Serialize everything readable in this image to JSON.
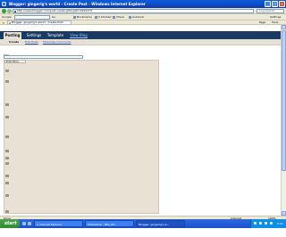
{
  "window": {
    "title": "Blogger: gingerig's world - Create Post - Windows Internet Explorer",
    "minimize_glyph": "_",
    "maximize_glyph": "□",
    "close_glyph": "✕"
  },
  "address": {
    "url": "http://www.blogger.com/post-create.g?blogID=2999370",
    "search_placeholder": "Live Search"
  },
  "toolbar": {
    "google_label": "Google",
    "go_label": "Go",
    "bookmarks": "Bookmarks",
    "blocked": "0 blocked",
    "check": "Check",
    "autolink": "AutoLink",
    "settings": "Settings"
  },
  "tab": {
    "title": "Blogger: gingerig's world - Create Post",
    "page_menu": "Page",
    "tools_menu": "Tools"
  },
  "blogger": {
    "tabs": [
      {
        "label": "Posting"
      },
      {
        "label": "Settings"
      },
      {
        "label": "Template"
      },
      {
        "label": "View Blog"
      }
    ],
    "subtabs": [
      {
        "label": "Create"
      },
      {
        "label": "Edit Posts"
      },
      {
        "label": "Moderate Comments"
      }
    ],
    "title_label": "Title:",
    "title_value": "",
    "editor_mode": "Edit Html"
  },
  "status": {
    "text": "Done",
    "zone": "Internet",
    "zoom": "100%"
  },
  "taskbar": {
    "start_label": "start",
    "items": [
      {
        "label": "2 Internet Explorer"
      },
      {
        "label": "Photoshop - IMG_00..."
      },
      {
        "label": "Blogger: gingerig's w..."
      }
    ],
    "clock": "9:41 PM"
  },
  "colors": {
    "nav_bg": "#183a63",
    "editor_bg": "#e8e1d4",
    "taskbar": "#245edb",
    "start": "#2f8a2f"
  }
}
